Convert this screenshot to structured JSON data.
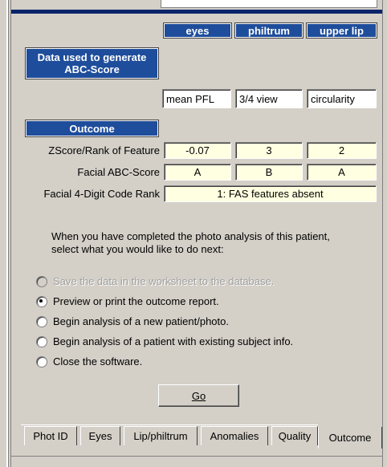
{
  "columns": [
    "eyes",
    "philtrum",
    "upper lip"
  ],
  "data_section": {
    "title": "Data used to generate ABC-Score",
    "values": [
      "mean PFL",
      "3/4 view",
      "circularity"
    ]
  },
  "outcome_section": {
    "title": "Outcome",
    "rows": [
      {
        "label": "ZScore/Rank of Feature",
        "values": [
          "-0.07",
          "3",
          "2"
        ]
      },
      {
        "label": "Facial ABC-Score",
        "values": [
          "A",
          "B",
          "A"
        ]
      }
    ],
    "code_label": "Facial 4-Digit Code Rank",
    "code_value": "1: FAS features absent"
  },
  "instruction": "When you have completed the photo analysis of this patient, select what you would like to do next:",
  "options": [
    {
      "label": "Save the data in the worksheet to the database.",
      "checked": false,
      "disabled": true
    },
    {
      "label": "Preview or print the outcome report.",
      "checked": true,
      "disabled": false
    },
    {
      "label": "Begin analysis of a new patient/photo.",
      "checked": false,
      "disabled": false
    },
    {
      "label": "Begin analysis of a patient with existing subject info.",
      "checked": false,
      "disabled": false
    },
    {
      "label": "Close the software.",
      "checked": false,
      "disabled": false
    }
  ],
  "go_button": "Go",
  "tabs": [
    "Phot ID",
    "Eyes",
    "Lip/philtrum",
    "Anomalies",
    "Quality",
    "Outcome"
  ],
  "active_tab": "Outcome",
  "colors": {
    "header_blue": "#1e4d9b",
    "navy_bar": "#0a246a",
    "window_face": "#d4d0c8",
    "highlight_cell": "#ffffe1"
  }
}
